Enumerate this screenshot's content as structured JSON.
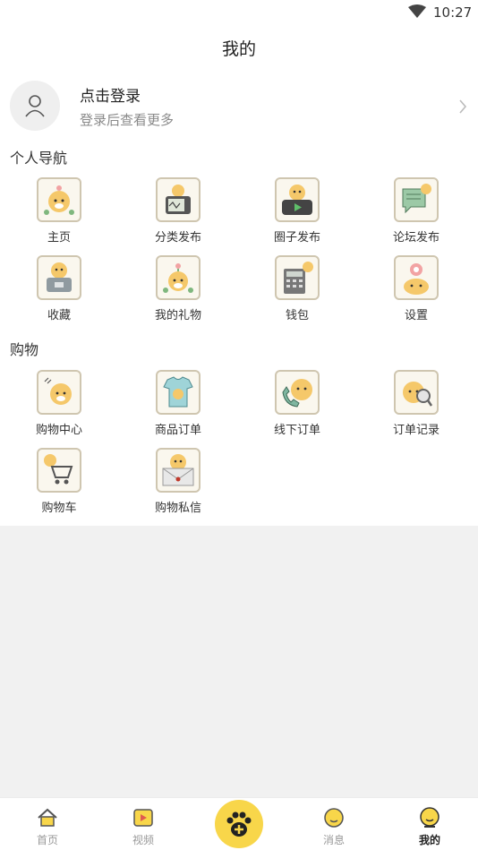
{
  "status_bar": {
    "time": "10:27",
    "wifi_icon": "wifi-icon"
  },
  "page_title": "我的",
  "login": {
    "title": "点击登录",
    "subtitle": "登录后查看更多",
    "avatar_icon": "user-icon",
    "arrow_icon": "chevron-right-icon"
  },
  "personal_nav": {
    "title": "个人导航",
    "items": [
      {
        "label": "主页",
        "icon": "home-dog-icon"
      },
      {
        "label": "分类发布",
        "icon": "tv-dog-icon"
      },
      {
        "label": "圈子发布",
        "icon": "video-dog-icon"
      },
      {
        "label": "论坛发布",
        "icon": "chat-dog-icon"
      },
      {
        "label": "收藏",
        "icon": "box-dog-icon"
      },
      {
        "label": "我的礼物",
        "icon": "gift-dog-icon"
      },
      {
        "label": "钱包",
        "icon": "calculator-dog-icon"
      },
      {
        "label": "设置",
        "icon": "flower-dog-icon"
      }
    ]
  },
  "shopping": {
    "title": "购物",
    "items": [
      {
        "label": "购物中心",
        "icon": "shop-dog-icon"
      },
      {
        "label": "商品订单",
        "icon": "shirt-dog-icon"
      },
      {
        "label": "线下订单",
        "icon": "phone-dog-icon"
      },
      {
        "label": "订单记录",
        "icon": "search-dog-icon"
      },
      {
        "label": "购物车",
        "icon": "cart-dog-icon"
      },
      {
        "label": "购物私信",
        "icon": "envelope-dog-icon"
      }
    ]
  },
  "tabbar": {
    "items": [
      {
        "label": "首页",
        "icon": "home-icon",
        "active": false
      },
      {
        "label": "视频",
        "icon": "video-icon",
        "active": false
      },
      {
        "label": "",
        "icon": "paw-plus-icon",
        "active": false
      },
      {
        "label": "消息",
        "icon": "message-icon",
        "active": false
      },
      {
        "label": "我的",
        "icon": "profile-icon",
        "active": true
      }
    ]
  },
  "colors": {
    "accent": "#f8d64a",
    "grey_bg": "#f1f1f1",
    "subtext": "#8a8a8a"
  }
}
